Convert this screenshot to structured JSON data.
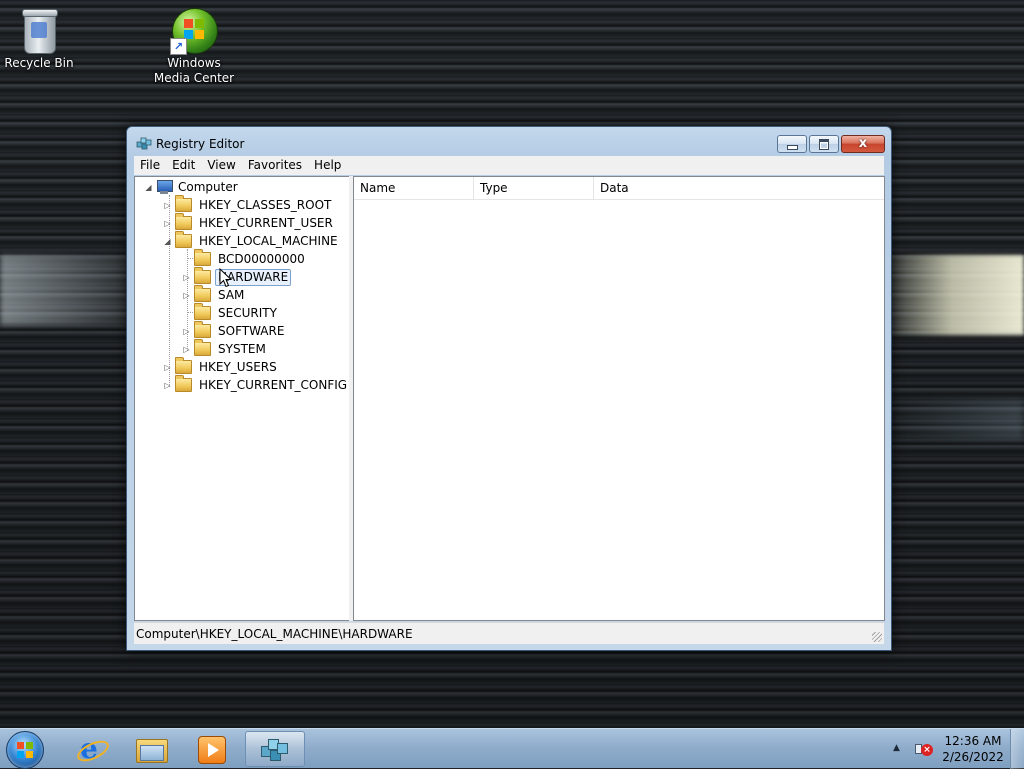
{
  "desktop": {
    "icons": [
      {
        "label": "Recycle Bin"
      },
      {
        "label_line1": "Windows",
        "label_line2": "Media Center"
      }
    ]
  },
  "window": {
    "title": "Registry Editor",
    "close_glyph": "x",
    "menu": [
      "File",
      "Edit",
      "View",
      "Favorites",
      "Help"
    ],
    "tree": {
      "root": "Computer",
      "hives": [
        "HKEY_CLASSES_ROOT",
        "HKEY_CURRENT_USER",
        "HKEY_LOCAL_MACHINE",
        "HKEY_USERS",
        "HKEY_CURRENT_CONFIG"
      ],
      "hklm_children": [
        "BCD00000000",
        "HARDWARE",
        "SAM",
        "SECURITY",
        "SOFTWARE",
        "SYSTEM"
      ],
      "selected": "HARDWARE"
    },
    "list_columns": [
      "Name",
      "Type",
      "Data"
    ],
    "status_path": "Computer\\HKEY_LOCAL_MACHINE\\HARDWARE"
  },
  "taskbar": {
    "clock_time": "12:36 AM",
    "clock_date": "2/26/2022"
  },
  "colors": {
    "selection_border": "#7da2ce",
    "selection_fill": "#e8f1fb",
    "taskbar": "#8eabca",
    "close_button": "#c7452e"
  }
}
